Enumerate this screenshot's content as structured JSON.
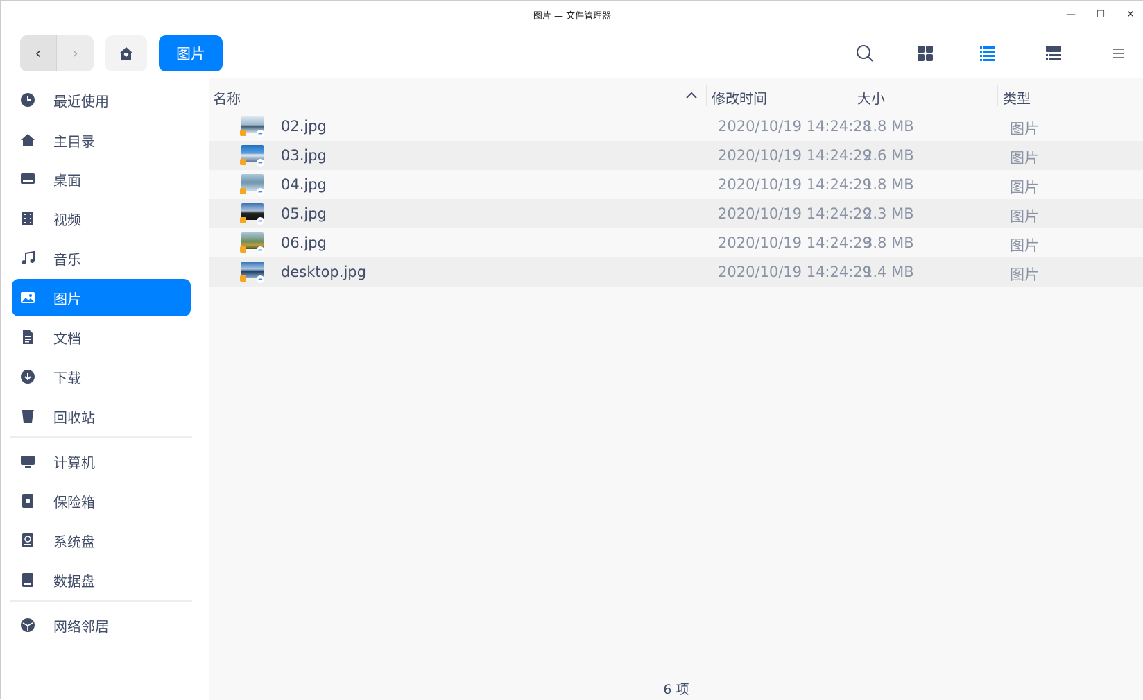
{
  "window": {
    "title": "图片 — 文件管理器",
    "minimize": "—",
    "maximize": "☐",
    "close": "✕"
  },
  "toolbar": {
    "back": "‹",
    "forward": "›",
    "breadcrumb": "图片",
    "accent": "#0081ff"
  },
  "sidebar": {
    "items": [
      {
        "label": "最近使用",
        "icon": "clock-icon"
      },
      {
        "label": "主目录",
        "icon": "home-icon"
      },
      {
        "label": "桌面",
        "icon": "desktop-icon"
      },
      {
        "label": "视频",
        "icon": "video-icon"
      },
      {
        "label": "音乐",
        "icon": "music-icon"
      },
      {
        "label": "图片",
        "icon": "picture-icon",
        "active": true
      },
      {
        "label": "文档",
        "icon": "document-icon"
      },
      {
        "label": "下载",
        "icon": "download-icon"
      },
      {
        "label": "回收站",
        "icon": "trash-icon"
      },
      {
        "label": "计算机",
        "icon": "computer-icon"
      },
      {
        "label": "保险箱",
        "icon": "vault-icon"
      },
      {
        "label": "系统盘",
        "icon": "system-disk-icon"
      },
      {
        "label": "数据盘",
        "icon": "data-disk-icon"
      },
      {
        "label": "网络邻居",
        "icon": "network-icon"
      }
    ]
  },
  "columns": {
    "name": "名称",
    "modified": "修改时间",
    "size": "大小",
    "type": "类型",
    "sort": "ascending"
  },
  "files": [
    {
      "name": "02.jpg",
      "modified": "2020/10/19 14:24:28",
      "size": "1.8 MB",
      "type": "图片"
    },
    {
      "name": "03.jpg",
      "modified": "2020/10/19 14:24:29",
      "size": "2.6 MB",
      "type": "图片"
    },
    {
      "name": "04.jpg",
      "modified": "2020/10/19 14:24:29",
      "size": "1.8 MB",
      "type": "图片"
    },
    {
      "name": "05.jpg",
      "modified": "2020/10/19 14:24:29",
      "size": "2.3 MB",
      "type": "图片"
    },
    {
      "name": "06.jpg",
      "modified": "2020/10/19 14:24:29",
      "size": "3.8 MB",
      "type": "图片"
    },
    {
      "name": "desktop.jpg",
      "modified": "2020/10/19 14:24:29",
      "size": "1.4 MB",
      "type": "图片"
    }
  ],
  "status": "6 项"
}
